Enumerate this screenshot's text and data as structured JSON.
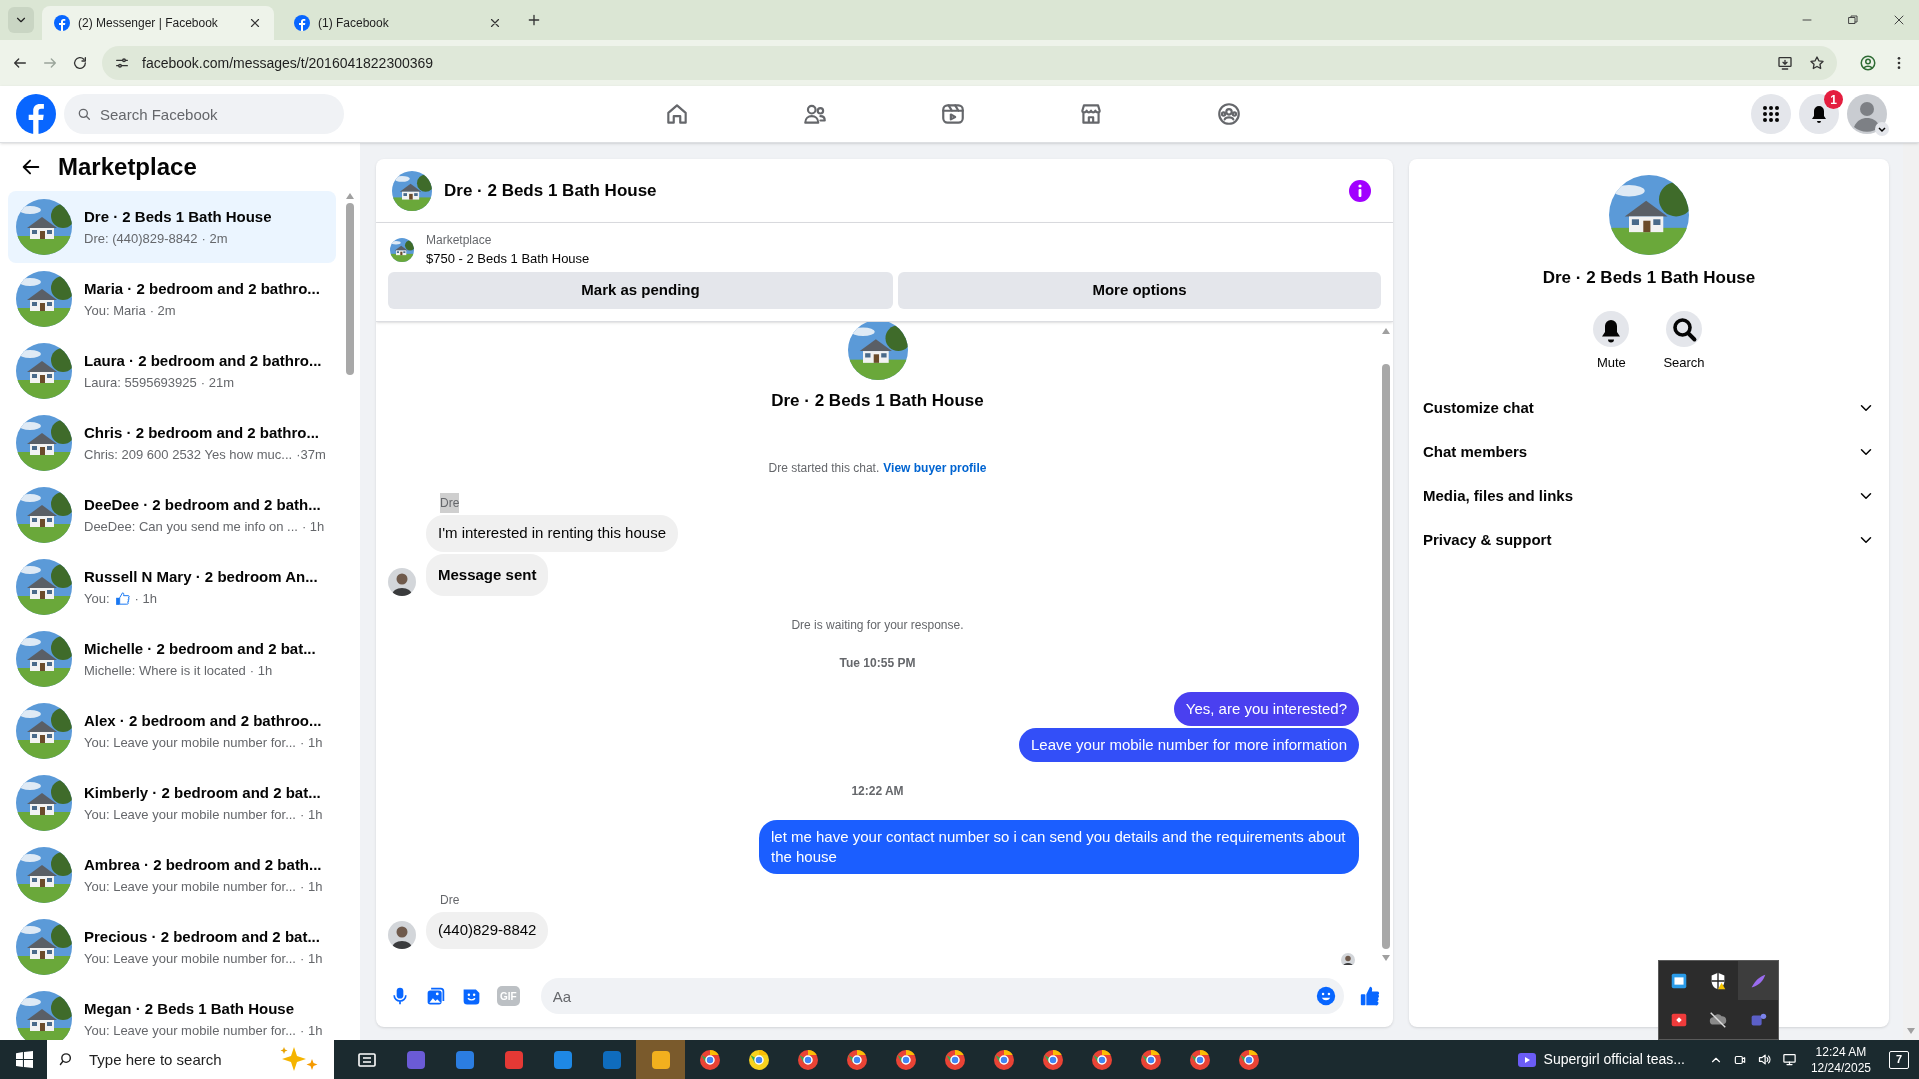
{
  "browser": {
    "tabs": [
      {
        "title": "(2) Messenger | Facebook",
        "selected": true
      },
      {
        "title": "(1) Facebook",
        "selected": false
      }
    ],
    "url": "facebook.com/messages/t/2016041822300369"
  },
  "header": {
    "search_placeholder": "Search Facebook",
    "notification_count": "1"
  },
  "sidebar": {
    "title": "Marketplace",
    "conversations": [
      {
        "name": "Dre · 2 Beds 1 Bath House",
        "kind": "text",
        "preview": "Dre: (440)829-8842",
        "time": "· 2m",
        "selected": true
      },
      {
        "name": "Maria · 2 bedroom and 2 bathro...",
        "kind": "text",
        "preview": "You: Maria",
        "time": "· 2m",
        "selected": false
      },
      {
        "name": "Laura · 2 bedroom and 2 bathro...",
        "kind": "text",
        "preview": "Laura: 5595693925",
        "time": "· 21m",
        "selected": false
      },
      {
        "name": "Chris · 2 bedroom and 2 bathro...",
        "kind": "text",
        "preview": "Chris: 209 600 2532 Yes how muc...",
        "time": "·37m",
        "selected": false
      },
      {
        "name": "DeeDee · 2 bedroom and 2 bath...",
        "kind": "text",
        "preview": "DeeDee: Can you send me info on ...",
        "time": "· 1h",
        "selected": false
      },
      {
        "name": "Russell N Mary · 2 bedroom An...",
        "kind": "like",
        "preview": "You:",
        "time": "· 1h",
        "selected": false
      },
      {
        "name": "Michelle · 2 bedroom and 2 bat...",
        "kind": "text",
        "preview": "Michelle: Where is it located",
        "time": "· 1h",
        "selected": false
      },
      {
        "name": "Alex · 2 bedroom and 2 bathroo...",
        "kind": "text",
        "preview": "You: Leave your mobile number for...",
        "time": "· 1h",
        "selected": false
      },
      {
        "name": "Kimberly · 2 bedroom and 2 bat...",
        "kind": "text",
        "preview": "You: Leave your mobile number for...",
        "time": "· 1h",
        "selected": false
      },
      {
        "name": "Ambrea · 2 bedroom and 2 bath...",
        "kind": "text",
        "preview": "You: Leave your mobile number for...",
        "time": "· 1h",
        "selected": false
      },
      {
        "name": "Precious · 2 bedroom and 2 bat...",
        "kind": "text",
        "preview": "You: Leave your mobile number for...",
        "time": "· 1h",
        "selected": false
      },
      {
        "name": "Megan · 2 Beds 1 Bath House",
        "kind": "text",
        "preview": "You: Leave your mobile number for...",
        "time": "· 1h",
        "selected": false
      }
    ]
  },
  "chat": {
    "title": "Dre · 2 Beds 1 Bath House",
    "listing": {
      "label": "Marketplace",
      "text": "$750 - 2 Beds 1 Bath House"
    },
    "buttons": [
      "Mark as pending",
      "More options"
    ],
    "messages": [
      {
        "kind": "intro",
        "text": "Dre · 2 Beds 1 Bath House"
      },
      {
        "kind": "notice",
        "text": "Dre started this chat.",
        "link": "View buyer profile"
      },
      {
        "kind": "sender",
        "text": "Dre",
        "highlighted": true
      },
      {
        "kind": "incoming",
        "text": "I'm interested in renting this house",
        "bold": false,
        "avatar": false
      },
      {
        "kind": "incoming",
        "text": "Message sent",
        "bold": true,
        "avatar": true
      },
      {
        "kind": "notice",
        "text": "Dre is waiting for your response."
      },
      {
        "kind": "time",
        "text": "Tue 10:55 PM"
      },
      {
        "kind": "outgoing",
        "text": "Yes, are you interested?"
      },
      {
        "kind": "outgoing",
        "text": "Leave your mobile number for more information"
      },
      {
        "kind": "time",
        "text": "12:22 AM"
      },
      {
        "kind": "outgoing",
        "text": "let me have your contact number so i can send you details and the requirements about the house"
      },
      {
        "kind": "sender",
        "text": "Dre",
        "highlighted": false
      },
      {
        "kind": "incoming",
        "text": "(440)829-8842",
        "bold": false,
        "avatar": true
      }
    ],
    "composer": {
      "gif_label": "GIF",
      "placeholder": "Aa"
    }
  },
  "details": {
    "title": "Dre · 2 Beds 1 Bath House",
    "actions": [
      "Mute",
      "Search"
    ],
    "sections": [
      {
        "label": "Customize chat",
        "expanded": false
      },
      {
        "label": "Chat members",
        "expanded": false
      },
      {
        "label": "Media, files and links",
        "expanded": false
      },
      {
        "label": "Privacy & support",
        "expanded": false
      }
    ]
  },
  "taskbar": {
    "search_placeholder": "Type here to search",
    "media": "Supergirl official teas...",
    "time": "12:24 AM",
    "date": "12/24/2025",
    "notification_count": "7"
  }
}
